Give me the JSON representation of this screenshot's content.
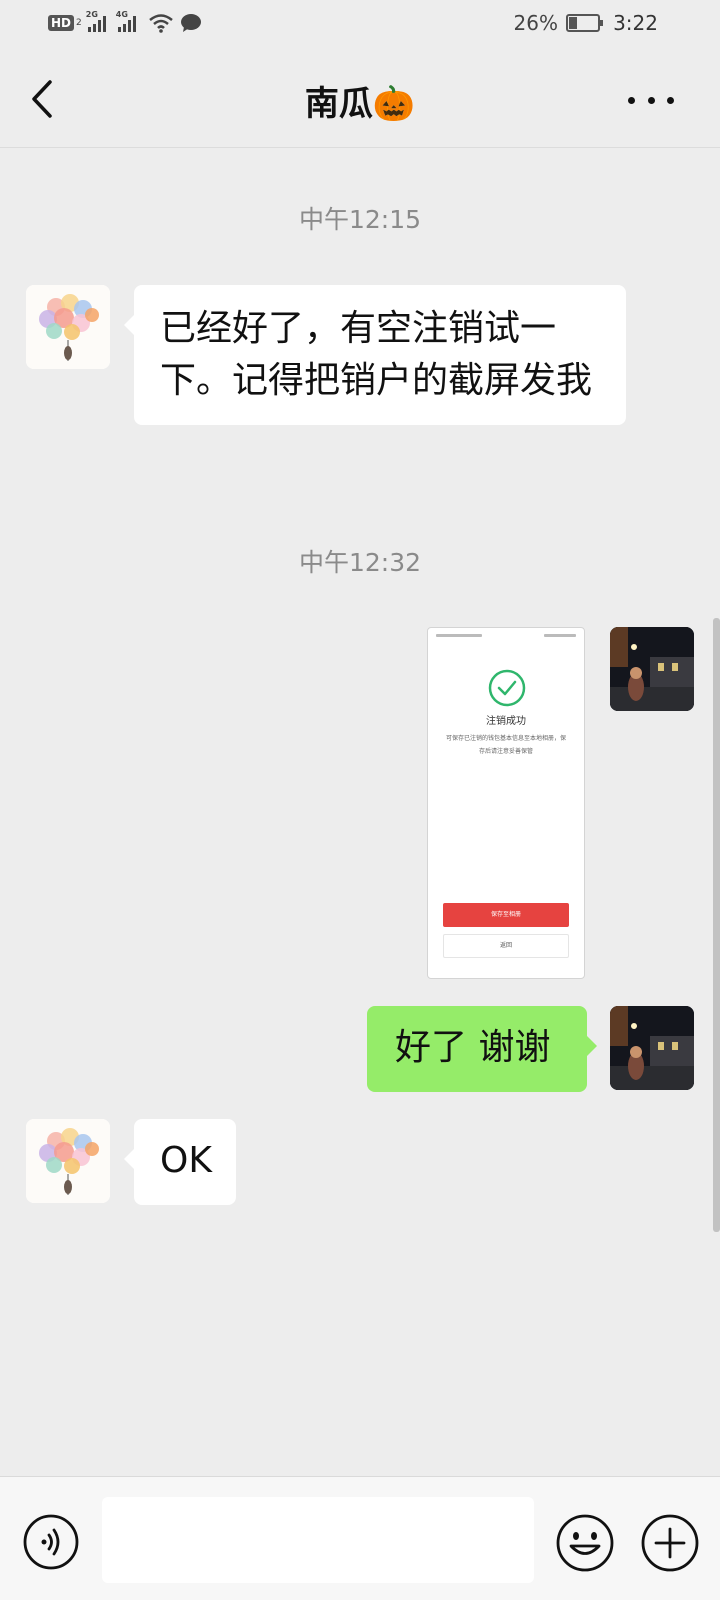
{
  "status_bar": {
    "hd_label": "HD",
    "hd_sub": "2",
    "sim1_label": "2G",
    "sim2_label": "4G",
    "battery": "26%",
    "battery_level": 0.26,
    "time": "3:22"
  },
  "nav": {
    "title": "南瓜🎃"
  },
  "messages": [
    {
      "timestamp": "中午12:15"
    },
    {
      "direction": "incoming",
      "text": "已经好了，有空注销试一下。记得把销户的截屏发我"
    },
    {
      "timestamp": "中午12:32"
    },
    {
      "direction": "outgoing",
      "type": "image",
      "image": {
        "title": "注销成功",
        "desc": "可保存已注销的钱包基本信息至本地相册，保存后请注意妥善保管",
        "primary_button": "保存至相册",
        "secondary_button": "返回"
      }
    },
    {
      "direction": "outgoing",
      "text": "好了 谢谢"
    },
    {
      "direction": "incoming",
      "text": "OK"
    }
  ],
  "input_bar": {
    "placeholder": ""
  },
  "icons": {
    "back": "chevron-left-icon",
    "more": "more-dots-icon",
    "voice": "voice-icon",
    "emoji": "emoji-icon",
    "plus": "plus-icon"
  },
  "colors": {
    "background": "#ededed",
    "outgoing_bubble": "#95ec69",
    "incoming_bubble": "#ffffff",
    "timestamp": "#8a8a8a"
  }
}
